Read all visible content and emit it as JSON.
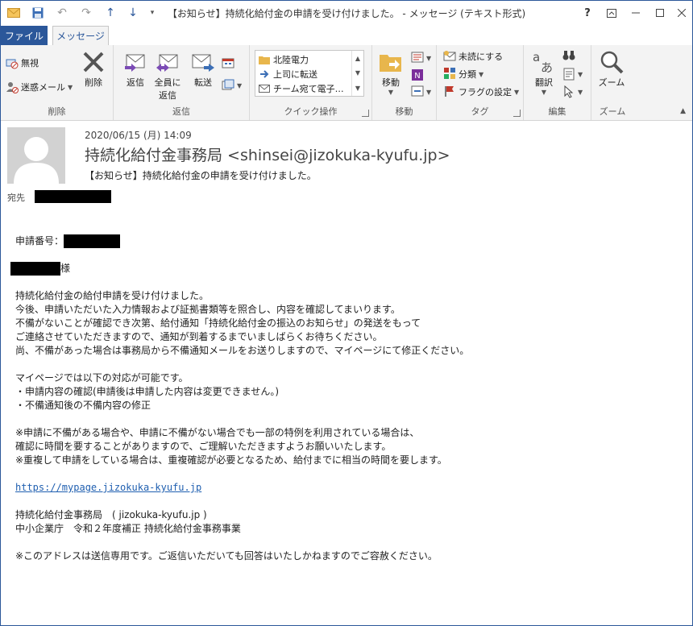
{
  "window": {
    "title": "【お知らせ】持続化給付金の申請を受け付けました。 - メッセージ (テキスト形式)",
    "help": "?"
  },
  "tabs": {
    "file": "ファイル",
    "message": "メッセージ"
  },
  "ribbon": {
    "delete_group": {
      "ignore": "無視",
      "junk": "迷惑メール",
      "delete": "削除",
      "label": "削除"
    },
    "respond_group": {
      "reply": "返信",
      "reply_all_1": "全員に",
      "reply_all_2": "返信",
      "forward": "転送",
      "label": "返信"
    },
    "quick_steps": {
      "items": [
        "北陸電力",
        "上司に転送",
        "チーム宛て電子…"
      ],
      "label": "クイック操作"
    },
    "move_group": {
      "move": "移動",
      "label": "移動"
    },
    "tags_group": {
      "unread": "未読にする",
      "categorize": "分類",
      "followup": "フラグの設定",
      "label": "タグ"
    },
    "edit_group": {
      "translate": "翻訳",
      "label": "編集"
    },
    "zoom_group": {
      "zoom": "ズーム",
      "label": "ズーム"
    }
  },
  "header": {
    "date": "2020/06/15 (月) 14:09",
    "sender": "持続化給付金事務局 <shinsei@jizokuka-kyufu.jp>",
    "subject": "【お知らせ】持続化給付金の申請を受け付けました。",
    "to_label": "宛先"
  },
  "body": {
    "app_number_label": "申請番号：",
    "honorific": "様",
    "p1": [
      "持続化給付金の給付申請を受け付けました。",
      "今後、申請いただいた入力情報および証拠書類等を照合し、内容を確認してまいります。",
      "不備がないことが確認でき次第、給付通知「持続化給付金の振込のお知らせ」の発送をもって",
      "ご連絡させていただきますので、通知が到着するまでいましばらくお待ちください。",
      "尚、不備があった場合は事務局から不備通知メールをお送りしますので、マイページにて修正ください。"
    ],
    "p2": [
      "マイページでは以下の対応が可能です。",
      "・申請内容の確認(申請後は申請した内容は変更できません。)",
      "・不備通知後の不備内容の修正"
    ],
    "p3": [
      "※申請に不備がある場合や、申請に不備がない場合でも一部の特例を利用されている場合は、",
      "確認に時間を要することがありますので、ご理解いただきますようお願いいたします。",
      "※重複して申請をしている場合は、重複確認が必要となるため、給付までに相当の時間を要します。"
    ],
    "link": "https://mypage.jizokuka-kyufu.jp",
    "signature": [
      "持続化給付金事務局　( jizokuka-kyufu.jp )",
      "中小企業庁　令和２年度補正 持続化給付金事務事業"
    ],
    "footer": "※このアドレスは送信専用です。ご返信いただいても回答はいたしかねますのでご容赦ください。"
  },
  "colors": {
    "accent": "#2b579a",
    "ribbon_bg": "#f3f3f3",
    "link": "#1f5fb0"
  }
}
